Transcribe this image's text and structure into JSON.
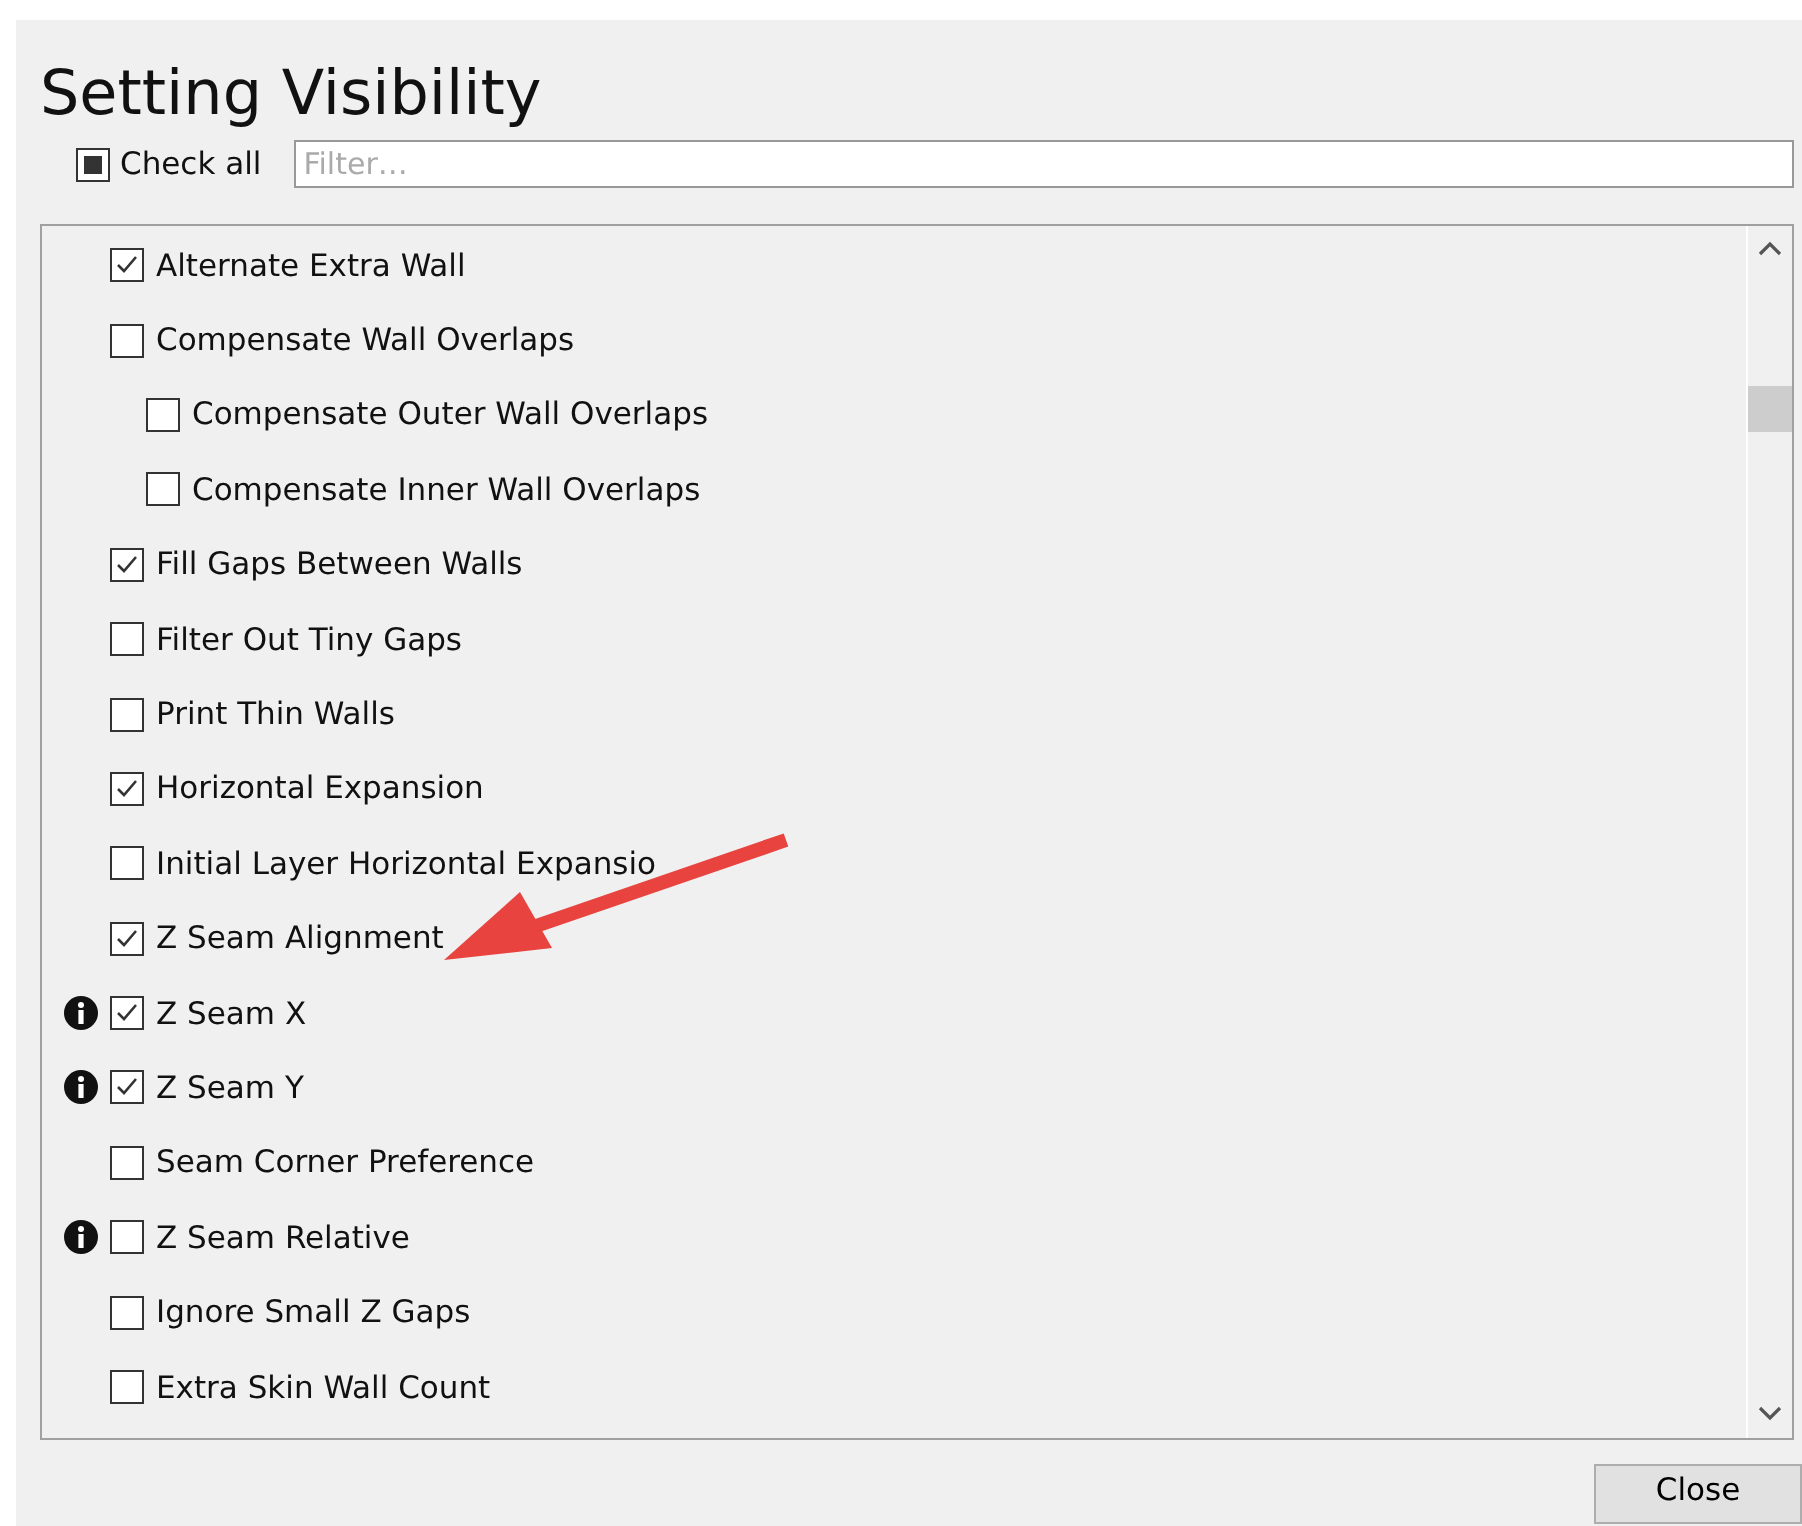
{
  "title": "Setting Visibility",
  "check_all": {
    "label": "Check all",
    "partial": true
  },
  "filter": {
    "placeholder": "Filter…"
  },
  "settings": [
    {
      "label": "Alternate Extra Wall",
      "checked": true,
      "info": false
    },
    {
      "label": "Compensate Wall Overlaps",
      "checked": false,
      "info": false,
      "children": [
        {
          "label": "Compensate Outer Wall Overlaps",
          "checked": false,
          "info": false
        },
        {
          "label": "Compensate Inner Wall Overlaps",
          "checked": false,
          "info": false
        }
      ]
    },
    {
      "label": "Fill Gaps Between Walls",
      "checked": true,
      "info": false
    },
    {
      "label": "Filter Out Tiny Gaps",
      "checked": false,
      "info": false
    },
    {
      "label": "Print Thin Walls",
      "checked": false,
      "info": false
    },
    {
      "label": "Horizontal Expansion",
      "checked": true,
      "info": false
    },
    {
      "label": "Initial Layer Horizontal Expansio",
      "checked": false,
      "info": false
    },
    {
      "label": "Z Seam Alignment",
      "checked": true,
      "info": false
    },
    {
      "label": "Z Seam X",
      "checked": true,
      "info": true
    },
    {
      "label": "Z Seam Y",
      "checked": true,
      "info": true
    },
    {
      "label": "Seam Corner Preference",
      "checked": false,
      "info": false
    },
    {
      "label": "Z Seam Relative",
      "checked": false,
      "info": true
    },
    {
      "label": "Ignore Small Z Gaps",
      "checked": false,
      "info": false
    },
    {
      "label": "Extra Skin Wall Count",
      "checked": false,
      "info": false
    }
  ],
  "close_button": "Close"
}
